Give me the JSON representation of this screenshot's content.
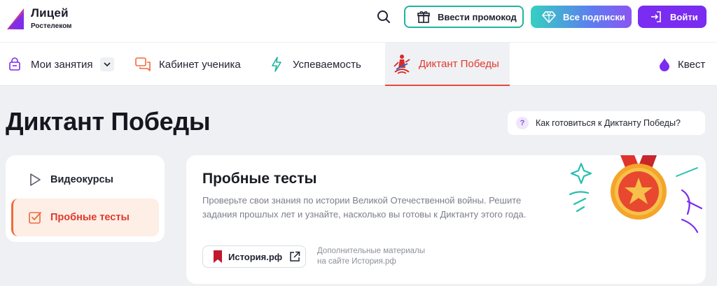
{
  "header": {
    "logo_title": "Лицей",
    "logo_sub": "Ростелеком",
    "promo_label": "Ввести промокод",
    "subs_label": "Все подписки",
    "login_label": "Войти"
  },
  "nav": {
    "items": [
      {
        "label": "Мои занятия",
        "icon": "graduation-cap-icon"
      },
      {
        "label": "Кабинет ученика",
        "icon": "chat-icon"
      },
      {
        "label": "Успеваемость",
        "icon": "lightning-icon"
      },
      {
        "label": "Диктант Победы",
        "icon": "victory-emblem-icon"
      },
      {
        "label": "Квест",
        "icon": "drop-icon"
      }
    ],
    "active_index": 3
  },
  "page": {
    "title": "Диктант Победы",
    "help_label": "Как готовиться к Диктанту Победы?",
    "help_mark": "?"
  },
  "sidebar": {
    "items": [
      {
        "label": "Видеокурсы",
        "icon": "play-icon"
      },
      {
        "label": "Пробные тесты",
        "icon": "checkbox-icon"
      }
    ],
    "active_index": 1
  },
  "card": {
    "title": "Пробные тесты",
    "description": "Проверьте свои знания по истории Великой Отечественной войны. Решите задания прошлых лет и узнайте, насколько вы готовы к Диктанту этого года.",
    "link_label": "История.рф",
    "note_line1": "Дополнительные материалы",
    "note_line2": "на сайте История.рф"
  },
  "colors": {
    "accent_red": "#e03a2e",
    "brand_purple": "#7a2cf0",
    "promo_border": "#1fb5a0"
  }
}
